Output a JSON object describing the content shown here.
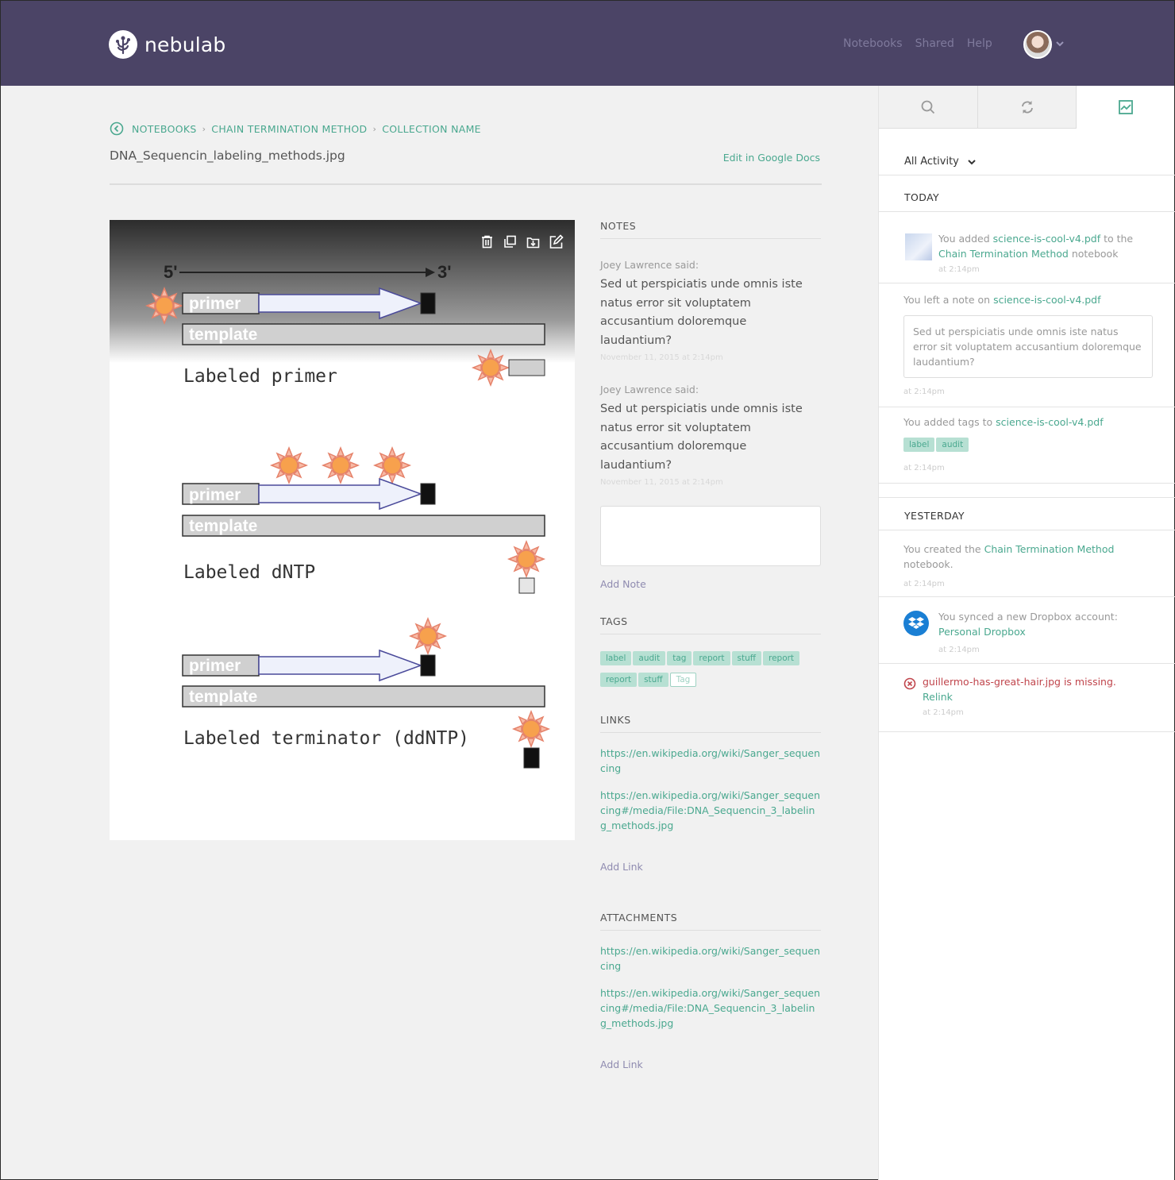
{
  "header": {
    "brand": "nebulab",
    "nav": [
      "Notebooks",
      "Shared",
      "Help"
    ]
  },
  "breadcrumb": {
    "items": [
      "NOTEBOOKS",
      "CHAIN TERMINATION METHOD",
      "COLLECTION NAME"
    ]
  },
  "file": {
    "name": "DNA_Sequencin_labeling_methods.jpg",
    "edit_label": "Edit in Google Docs"
  },
  "diagram": {
    "end5": "5'",
    "end3": "3'",
    "primer": "primer",
    "template": "template",
    "label1": "Labeled primer",
    "label2": "Labeled dNTP",
    "label3": "Labeled terminator (ddNTP)"
  },
  "notes": {
    "heading": "NOTES",
    "items": [
      {
        "author": "Joey Lawrence said:",
        "text": "Sed ut perspiciatis unde omnis iste natus error sit voluptatem accusantium doloremque laudantium?",
        "time": "November 11, 2015 at 2:14pm"
      },
      {
        "author": "Joey Lawrence said:",
        "text": "Sed ut perspiciatis unde omnis iste natus error sit voluptatem accusantium doloremque laudantium?",
        "time": "November 11, 2015 at 2:14pm"
      }
    ],
    "add_label": "Add Note"
  },
  "tags": {
    "heading": "TAGS",
    "items": [
      "label",
      "audit",
      "tag",
      "report",
      "stuff",
      "report",
      "report",
      "stuff"
    ],
    "new_placeholder": "Tag"
  },
  "links": {
    "heading": "LINKS",
    "items": [
      "https://en.wikipedia.org/wiki/Sanger_sequencing",
      "https://en.wikipedia.org/wiki/Sanger_sequencing#/media/File:DNA_Sequencin_3_labeling_methods.jpg"
    ],
    "add_label": "Add Link"
  },
  "attachments": {
    "heading": "ATTACHMENTS",
    "items": [
      "https://en.wikipedia.org/wiki/Sanger_sequencing",
      "https://en.wikipedia.org/wiki/Sanger_sequencing#/media/File:DNA_Sequencin_3_labeling_methods.jpg"
    ],
    "add_label": "Add Link"
  },
  "activity": {
    "filter": "All Activity",
    "today": "TODAY",
    "yesterday": "YESTERDAY",
    "a1": {
      "pre": "You added ",
      "file": "science-is-cool-v4.pdf",
      "mid": " to the ",
      "notebook": "Chain Termination Method",
      "post": " notebook",
      "time": "at 2:14pm"
    },
    "a2": {
      "pre": "You left a note on ",
      "file": "science-is-cool-v4.pdf",
      "quote": "Sed ut perspiciatis unde omnis iste natus error sit voluptatem accusantium doloremque laudantium?",
      "time": "at 2:14pm"
    },
    "a3": {
      "pre": "You added tags to ",
      "file": "science-is-cool-v4.pdf",
      "tags": [
        "label",
        "audit"
      ],
      "time": "at 2:14pm"
    },
    "a4": {
      "pre": "You created the ",
      "notebook": "Chain Termination Method",
      "post": " notebook.",
      "time": "at 2:14pm"
    },
    "a5": {
      "pre": "You synced a new Dropbox account:",
      "account": "Personal Dropbox",
      "time": "at 2:14pm"
    },
    "a6": {
      "msg": "guillermo-has-great-hair.jpg is missing.",
      "action": "Relink",
      "time": "at 2:14pm"
    }
  }
}
